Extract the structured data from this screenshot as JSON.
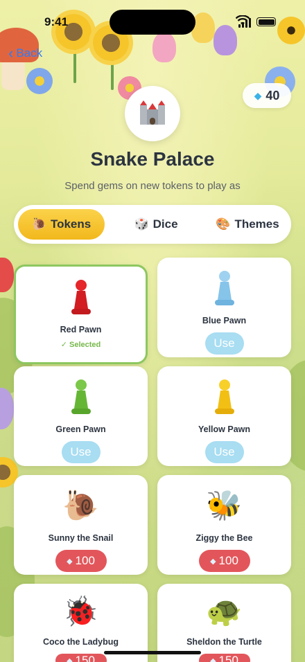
{
  "status_bar": {
    "time": "9:41"
  },
  "nav": {
    "back_label": "Back"
  },
  "wallet": {
    "gems": "40"
  },
  "header": {
    "title": "Snake Palace",
    "subtitle": "Spend gems on new tokens to play as"
  },
  "tabs": [
    {
      "label": "Tokens",
      "icon": "snail-icon",
      "active": true
    },
    {
      "label": "Dice",
      "icon": "dice-icon",
      "active": false
    },
    {
      "label": "Themes",
      "icon": "palette-icon",
      "active": false
    }
  ],
  "tokens": [
    {
      "name": "Red Pawn",
      "state": "selected",
      "status_label": "✓ Selected",
      "color": "#e5262a"
    },
    {
      "name": "Blue Pawn",
      "state": "owned",
      "action_label": "Use",
      "color": "#8cc8ec"
    },
    {
      "name": "Green Pawn",
      "state": "owned",
      "action_label": "Use",
      "color": "#6cbd3a"
    },
    {
      "name": "Yellow Pawn",
      "state": "owned",
      "action_label": "Use",
      "color": "#f6c51a"
    },
    {
      "name": "Sunny the Snail",
      "state": "locked",
      "price": "100",
      "icon": "snail-icon"
    },
    {
      "name": "Ziggy the Bee",
      "state": "locked",
      "price": "100",
      "icon": "bee-icon"
    },
    {
      "name": "Coco the Ladybug",
      "state": "locked",
      "price": "150",
      "icon": "ladybug-icon"
    },
    {
      "name": "Sheldon the Turtle",
      "state": "locked",
      "price": "150",
      "icon": "turtle-icon"
    }
  ],
  "colors": {
    "accent_tab": "#f2b81c",
    "use_button": "#a8ddf2",
    "price_button": "#e2565b",
    "selected_border": "#8dc760",
    "back_link": "#2f7cf6"
  }
}
